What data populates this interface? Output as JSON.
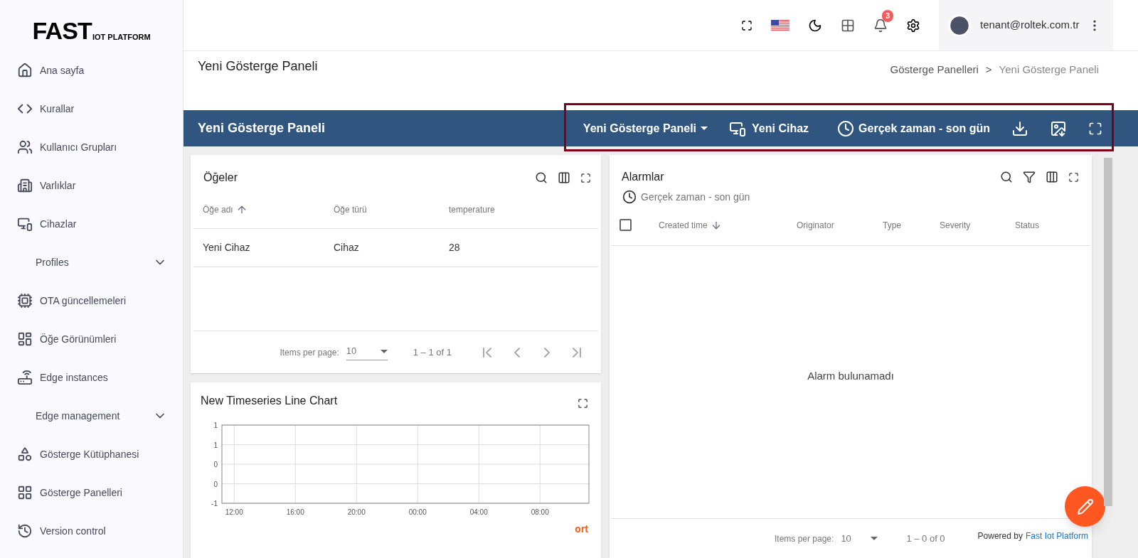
{
  "sidebar": {
    "logo": {
      "main": "FAST",
      "sub": "IOT PLATFORM"
    },
    "items": [
      {
        "kind": "link",
        "label": "Ana sayfa"
      },
      {
        "kind": "link",
        "label": "Kurallar"
      },
      {
        "kind": "link",
        "label": "Kullanıcı Grupları"
      },
      {
        "kind": "link",
        "label": "Varlıklar"
      },
      {
        "kind": "link",
        "label": "Cihazlar"
      },
      {
        "kind": "group",
        "label": "Profiles",
        "expanded": false
      },
      {
        "kind": "link",
        "label": "OTA güncellemeleri"
      },
      {
        "kind": "link",
        "label": "Öğe Görünümleri"
      },
      {
        "kind": "link",
        "label": "Edge instances"
      },
      {
        "kind": "group",
        "label": "Edge management",
        "expanded": false
      },
      {
        "kind": "link",
        "label": "Gösterge Kütüphanesi"
      },
      {
        "kind": "link",
        "label": "Gösterge Panelleri"
      },
      {
        "kind": "link",
        "label": "Version control"
      }
    ]
  },
  "topbar": {
    "notification_count": "3",
    "user_email": "tenant@roltek.com.tr"
  },
  "page_header": {
    "title": "Yeni Gösterge Paneli",
    "breadcrumb": [
      "Gösterge Panelleri",
      "Yeni Gösterge Paneli"
    ],
    "breadcrumb_separator": ">"
  },
  "dashboard_bar": {
    "title": "Yeni Gösterge Paneli",
    "state_menu": "Yeni Gösterge Paneli",
    "entity": "Yeni Cihaz",
    "timewindow": "Gerçek zaman - son gün"
  },
  "entities_widget": {
    "title": "Öğeler",
    "columns": [
      {
        "label": "Öğe adı",
        "sorted": true,
        "descending": false
      },
      {
        "label": "Öğe türü",
        "sorted": false
      },
      {
        "label": "temperature",
        "sorted": false
      }
    ],
    "rows": [
      [
        "Yeni Cihaz",
        "Cihaz",
        "28"
      ]
    ],
    "pagination": {
      "label": "Items per page:",
      "page_size": "10",
      "range": "1 – 1 of 1"
    }
  },
  "chart_widget": {
    "title": "New Timeseries Line Chart",
    "legend_label": "ort",
    "chart_data": {
      "type": "line",
      "grid": true,
      "ylim": [
        -1,
        1
      ],
      "categories": [
        "12:00",
        "16:00",
        "20:00",
        "00:00",
        "04:00",
        "08:00"
      ],
      "yticks": [
        {
          "value": -1,
          "label": "-1"
        },
        {
          "value": -0.5,
          "label": "0"
        },
        {
          "value": 0,
          "label": "0"
        },
        {
          "value": 0.5,
          "label": "1"
        },
        {
          "value": 1,
          "label": "1"
        }
      ]
    }
  },
  "alarms_widget": {
    "title": "Alarmlar",
    "timewindow": "Gerçek zaman - son gün",
    "select_all_checked": false,
    "columns": [
      {
        "label": "Created time",
        "sorted": true,
        "descending": true
      },
      {
        "label": "Originator",
        "sorted": false
      },
      {
        "label": "Type",
        "sorted": false
      },
      {
        "label": "Severity",
        "sorted": false
      },
      {
        "label": "Status",
        "sorted": false
      }
    ],
    "empty_message": "Alarm bulunamadı",
    "pagination": {
      "label": "Items per page:",
      "page_size": "10",
      "range": "1 – 0 of 0"
    }
  },
  "footer": {
    "powered_by": "Powered by",
    "link": "Fast Iot Platform"
  }
}
